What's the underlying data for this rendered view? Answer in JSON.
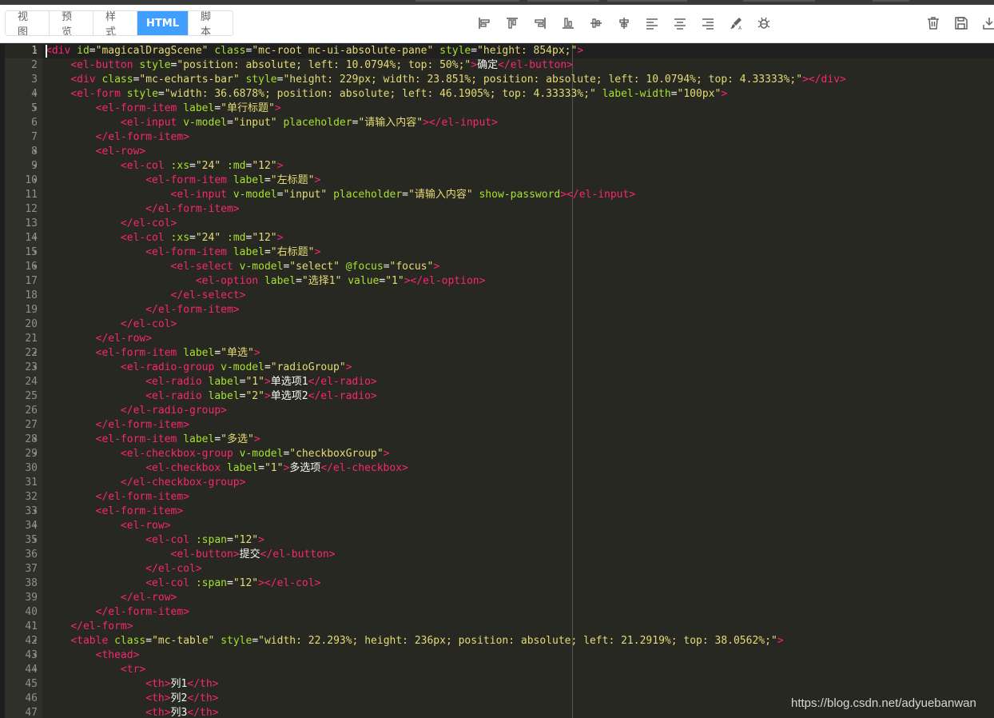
{
  "tabs": [
    {
      "label": "视图",
      "active": false
    },
    {
      "label": "预览",
      "active": false
    },
    {
      "label": "样式",
      "active": false
    },
    {
      "label": "HTML",
      "active": true
    },
    {
      "label": "脚本",
      "active": false
    }
  ],
  "toolbar_icons": [
    "align-left-icon",
    "align-top-icon",
    "align-right-icon",
    "align-bottom-icon",
    "vertical-center-icon",
    "horizontal-center-icon",
    "text-align-left-icon",
    "text-align-center-icon",
    "text-align-right-icon",
    "brush-icon",
    "bug-icon"
  ],
  "right_icons": [
    "delete-icon",
    "save-icon",
    "download-icon"
  ],
  "colors": {
    "accent": "#409eff",
    "tag": "#f92672",
    "attr": "#a6e22e",
    "string": "#e6db74",
    "text": "#f8f8f2",
    "editor_bg": "#272822"
  },
  "editor": {
    "lines": [
      [
        [
          "t",
          "<div"
        ],
        [
          "p",
          " "
        ],
        [
          "a",
          "id"
        ],
        [
          "p",
          "="
        ],
        [
          "s",
          "\"magicalDragScene\""
        ],
        [
          "p",
          " "
        ],
        [
          "a",
          "class"
        ],
        [
          "p",
          "="
        ],
        [
          "s",
          "\"mc-root mc-ui-absolute-pane\""
        ],
        [
          "p",
          " "
        ],
        [
          "a",
          "style"
        ],
        [
          "p",
          "="
        ],
        [
          "s",
          "\"height: 854px;\""
        ],
        [
          "t",
          ">"
        ]
      ],
      [
        [
          "p",
          "    "
        ],
        [
          "t",
          "<el-button"
        ],
        [
          "p",
          " "
        ],
        [
          "a",
          "style"
        ],
        [
          "p",
          "="
        ],
        [
          "s",
          "\"position: absolute; left: 10.0794%; top: 50%;\""
        ],
        [
          "t",
          ">"
        ],
        [
          "x",
          "确定"
        ],
        [
          "t",
          "</el-button>"
        ]
      ],
      [
        [
          "p",
          "    "
        ],
        [
          "t",
          "<div"
        ],
        [
          "p",
          " "
        ],
        [
          "a",
          "class"
        ],
        [
          "p",
          "="
        ],
        [
          "s",
          "\"mc-echarts-bar\""
        ],
        [
          "p",
          " "
        ],
        [
          "a",
          "style"
        ],
        [
          "p",
          "="
        ],
        [
          "s",
          "\"height: 229px; width: 23.851%; position: absolute; left: 10.0794%; top: 4.33333%;\""
        ],
        [
          "t",
          ">"
        ],
        [
          "t",
          "</div>"
        ]
      ],
      [
        [
          "p",
          "    "
        ],
        [
          "t",
          "<el-form"
        ],
        [
          "p",
          " "
        ],
        [
          "a",
          "style"
        ],
        [
          "p",
          "="
        ],
        [
          "s",
          "\"width: 36.6878%; position: absolute; left: 46.1905%; top: 4.33333%;\""
        ],
        [
          "p",
          " "
        ],
        [
          "a",
          "label-width"
        ],
        [
          "p",
          "="
        ],
        [
          "s",
          "\"100px\""
        ],
        [
          "t",
          ">"
        ]
      ],
      [
        [
          "p",
          "        "
        ],
        [
          "t",
          "<el-form-item"
        ],
        [
          "p",
          " "
        ],
        [
          "a",
          "label"
        ],
        [
          "p",
          "="
        ],
        [
          "s",
          "\"单行标题\""
        ],
        [
          "t",
          ">"
        ]
      ],
      [
        [
          "p",
          "            "
        ],
        [
          "t",
          "<el-input"
        ],
        [
          "p",
          " "
        ],
        [
          "a",
          "v-model"
        ],
        [
          "p",
          "="
        ],
        [
          "s",
          "\"input\""
        ],
        [
          "p",
          " "
        ],
        [
          "a",
          "placeholder"
        ],
        [
          "p",
          "="
        ],
        [
          "s",
          "\"请输入内容\""
        ],
        [
          "t",
          ">"
        ],
        [
          "t",
          "</el-input>"
        ]
      ],
      [
        [
          "p",
          "        "
        ],
        [
          "t",
          "</el-form-item>"
        ]
      ],
      [
        [
          "p",
          "        "
        ],
        [
          "t",
          "<el-row>"
        ]
      ],
      [
        [
          "p",
          "            "
        ],
        [
          "t",
          "<el-col"
        ],
        [
          "p",
          " "
        ],
        [
          "a",
          ":xs"
        ],
        [
          "p",
          "="
        ],
        [
          "s",
          "\"24\""
        ],
        [
          "p",
          " "
        ],
        [
          "a",
          ":md"
        ],
        [
          "p",
          "="
        ],
        [
          "s",
          "\"12\""
        ],
        [
          "t",
          ">"
        ]
      ],
      [
        [
          "p",
          "                "
        ],
        [
          "t",
          "<el-form-item"
        ],
        [
          "p",
          " "
        ],
        [
          "a",
          "label"
        ],
        [
          "p",
          "="
        ],
        [
          "s",
          "\"左标题\""
        ],
        [
          "t",
          ">"
        ]
      ],
      [
        [
          "p",
          "                    "
        ],
        [
          "t",
          "<el-input"
        ],
        [
          "p",
          " "
        ],
        [
          "a",
          "v-model"
        ],
        [
          "p",
          "="
        ],
        [
          "s",
          "\"input\""
        ],
        [
          "p",
          " "
        ],
        [
          "a",
          "placeholder"
        ],
        [
          "p",
          "="
        ],
        [
          "s",
          "\"请输入内容\""
        ],
        [
          "p",
          " "
        ],
        [
          "a",
          "show-password"
        ],
        [
          "t",
          ">"
        ],
        [
          "t",
          "</el-input>"
        ]
      ],
      [
        [
          "p",
          "                "
        ],
        [
          "t",
          "</el-form-item>"
        ]
      ],
      [
        [
          "p",
          "            "
        ],
        [
          "t",
          "</el-col>"
        ]
      ],
      [
        [
          "p",
          "            "
        ],
        [
          "t",
          "<el-col"
        ],
        [
          "p",
          " "
        ],
        [
          "a",
          ":xs"
        ],
        [
          "p",
          "="
        ],
        [
          "s",
          "\"24\""
        ],
        [
          "p",
          " "
        ],
        [
          "a",
          ":md"
        ],
        [
          "p",
          "="
        ],
        [
          "s",
          "\"12\""
        ],
        [
          "t",
          ">"
        ]
      ],
      [
        [
          "p",
          "                "
        ],
        [
          "t",
          "<el-form-item"
        ],
        [
          "p",
          " "
        ],
        [
          "a",
          "label"
        ],
        [
          "p",
          "="
        ],
        [
          "s",
          "\"右标题\""
        ],
        [
          "t",
          ">"
        ]
      ],
      [
        [
          "p",
          "                    "
        ],
        [
          "t",
          "<el-select"
        ],
        [
          "p",
          " "
        ],
        [
          "a",
          "v-model"
        ],
        [
          "p",
          "="
        ],
        [
          "s",
          "\"select\""
        ],
        [
          "p",
          " "
        ],
        [
          "a",
          "@focus"
        ],
        [
          "p",
          "="
        ],
        [
          "s",
          "\"focus\""
        ],
        [
          "t",
          ">"
        ]
      ],
      [
        [
          "p",
          "                        "
        ],
        [
          "t",
          "<el-option"
        ],
        [
          "p",
          " "
        ],
        [
          "a",
          "label"
        ],
        [
          "p",
          "="
        ],
        [
          "s",
          "\"选择1\""
        ],
        [
          "p",
          " "
        ],
        [
          "a",
          "value"
        ],
        [
          "p",
          "="
        ],
        [
          "s",
          "\"1\""
        ],
        [
          "t",
          ">"
        ],
        [
          "t",
          "</el-option>"
        ]
      ],
      [
        [
          "p",
          "                    "
        ],
        [
          "t",
          "</el-select>"
        ]
      ],
      [
        [
          "p",
          "                "
        ],
        [
          "t",
          "</el-form-item>"
        ]
      ],
      [
        [
          "p",
          "            "
        ],
        [
          "t",
          "</el-col>"
        ]
      ],
      [
        [
          "p",
          "        "
        ],
        [
          "t",
          "</el-row>"
        ]
      ],
      [
        [
          "p",
          "        "
        ],
        [
          "t",
          "<el-form-item"
        ],
        [
          "p",
          " "
        ],
        [
          "a",
          "label"
        ],
        [
          "p",
          "="
        ],
        [
          "s",
          "\"单选\""
        ],
        [
          "t",
          ">"
        ]
      ],
      [
        [
          "p",
          "            "
        ],
        [
          "t",
          "<el-radio-group"
        ],
        [
          "p",
          " "
        ],
        [
          "a",
          "v-model"
        ],
        [
          "p",
          "="
        ],
        [
          "s",
          "\"radioGroup\""
        ],
        [
          "t",
          ">"
        ]
      ],
      [
        [
          "p",
          "                "
        ],
        [
          "t",
          "<el-radio"
        ],
        [
          "p",
          " "
        ],
        [
          "a",
          "label"
        ],
        [
          "p",
          "="
        ],
        [
          "s",
          "\"1\""
        ],
        [
          "t",
          ">"
        ],
        [
          "x",
          "单选项1"
        ],
        [
          "t",
          "</el-radio>"
        ]
      ],
      [
        [
          "p",
          "                "
        ],
        [
          "t",
          "<el-radio"
        ],
        [
          "p",
          " "
        ],
        [
          "a",
          "label"
        ],
        [
          "p",
          "="
        ],
        [
          "s",
          "\"2\""
        ],
        [
          "t",
          ">"
        ],
        [
          "x",
          "单选项2"
        ],
        [
          "t",
          "</el-radio>"
        ]
      ],
      [
        [
          "p",
          "            "
        ],
        [
          "t",
          "</el-radio-group>"
        ]
      ],
      [
        [
          "p",
          "        "
        ],
        [
          "t",
          "</el-form-item>"
        ]
      ],
      [
        [
          "p",
          "        "
        ],
        [
          "t",
          "<el-form-item"
        ],
        [
          "p",
          " "
        ],
        [
          "a",
          "label"
        ],
        [
          "p",
          "="
        ],
        [
          "s",
          "\"多选\""
        ],
        [
          "t",
          ">"
        ]
      ],
      [
        [
          "p",
          "            "
        ],
        [
          "t",
          "<el-checkbox-group"
        ],
        [
          "p",
          " "
        ],
        [
          "a",
          "v-model"
        ],
        [
          "p",
          "="
        ],
        [
          "s",
          "\"checkboxGroup\""
        ],
        [
          "t",
          ">"
        ]
      ],
      [
        [
          "p",
          "                "
        ],
        [
          "t",
          "<el-checkbox"
        ],
        [
          "p",
          " "
        ],
        [
          "a",
          "label"
        ],
        [
          "p",
          "="
        ],
        [
          "s",
          "\"1\""
        ],
        [
          "t",
          ">"
        ],
        [
          "x",
          "多选项"
        ],
        [
          "t",
          "</el-checkbox>"
        ]
      ],
      [
        [
          "p",
          "            "
        ],
        [
          "t",
          "</el-checkbox-group>"
        ]
      ],
      [
        [
          "p",
          "        "
        ],
        [
          "t",
          "</el-form-item>"
        ]
      ],
      [
        [
          "p",
          "        "
        ],
        [
          "t",
          "<el-form-item>"
        ]
      ],
      [
        [
          "p",
          "            "
        ],
        [
          "t",
          "<el-row>"
        ]
      ],
      [
        [
          "p",
          "                "
        ],
        [
          "t",
          "<el-col"
        ],
        [
          "p",
          " "
        ],
        [
          "a",
          ":span"
        ],
        [
          "p",
          "="
        ],
        [
          "s",
          "\"12\""
        ],
        [
          "t",
          ">"
        ]
      ],
      [
        [
          "p",
          "                    "
        ],
        [
          "t",
          "<el-button>"
        ],
        [
          "x",
          "提交"
        ],
        [
          "t",
          "</el-button>"
        ]
      ],
      [
        [
          "p",
          "                "
        ],
        [
          "t",
          "</el-col>"
        ]
      ],
      [
        [
          "p",
          "                "
        ],
        [
          "t",
          "<el-col"
        ],
        [
          "p",
          " "
        ],
        [
          "a",
          ":span"
        ],
        [
          "p",
          "="
        ],
        [
          "s",
          "\"12\""
        ],
        [
          "t",
          ">"
        ],
        [
          "t",
          "</el-col>"
        ]
      ],
      [
        [
          "p",
          "            "
        ],
        [
          "t",
          "</el-row>"
        ]
      ],
      [
        [
          "p",
          "        "
        ],
        [
          "t",
          "</el-form-item>"
        ]
      ],
      [
        [
          "p",
          "    "
        ],
        [
          "t",
          "</el-form>"
        ]
      ],
      [
        [
          "p",
          "    "
        ],
        [
          "t",
          "<table"
        ],
        [
          "p",
          " "
        ],
        [
          "a",
          "class"
        ],
        [
          "p",
          "="
        ],
        [
          "s",
          "\"mc-table\""
        ],
        [
          "p",
          " "
        ],
        [
          "a",
          "style"
        ],
        [
          "p",
          "="
        ],
        [
          "s",
          "\"width: 22.293%; height: 236px; position: absolute; left: 21.2919%; top: 38.0562%;\""
        ],
        [
          "t",
          ">"
        ]
      ],
      [
        [
          "p",
          "        "
        ],
        [
          "t",
          "<thead>"
        ]
      ],
      [
        [
          "p",
          "            "
        ],
        [
          "t",
          "<tr>"
        ]
      ],
      [
        [
          "p",
          "                "
        ],
        [
          "t",
          "<th>"
        ],
        [
          "x",
          "列1"
        ],
        [
          "t",
          "</th>"
        ]
      ],
      [
        [
          "p",
          "                "
        ],
        [
          "t",
          "<th>"
        ],
        [
          "x",
          "列2"
        ],
        [
          "t",
          "</th>"
        ]
      ],
      [
        [
          "p",
          "                "
        ],
        [
          "t",
          "<th>"
        ],
        [
          "x",
          "列3"
        ],
        [
          "t",
          "</th>"
        ]
      ]
    ],
    "fold_lines": [
      1,
      4,
      5,
      8,
      9,
      10,
      14,
      15,
      16,
      22,
      23,
      28,
      29,
      33,
      34,
      35,
      42,
      43,
      44
    ]
  },
  "watermark": "https://blog.csdn.net/adyuebanwan"
}
